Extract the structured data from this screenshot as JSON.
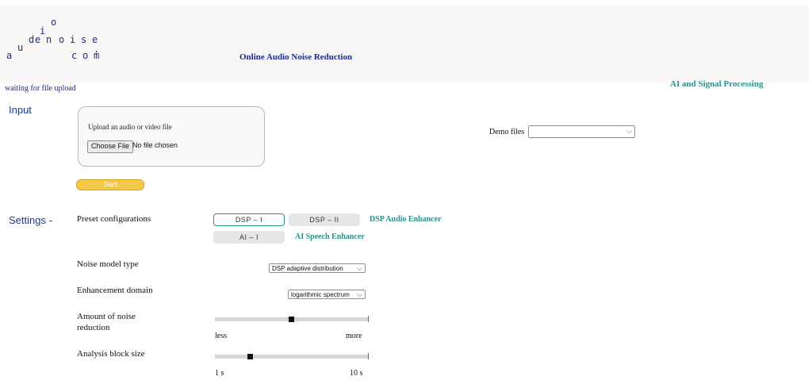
{
  "header": {
    "logo_letters": [
      "a",
      "u",
      "d",
      "i",
      "o",
      "e",
      "n",
      "o",
      "i",
      "s",
      "e",
      ".",
      "c",
      "o",
      "m"
    ],
    "site_title": "Online Audio Noise Reduction",
    "tagline": "AI and Signal Processing"
  },
  "status_text": "waiting for file upload",
  "input": {
    "section_label": "Input",
    "upload_label": "Upload an audio or video file",
    "choose_file_label": "Choose File",
    "file_status": "No file chosen",
    "start_label": "Start",
    "demo_label": "Demo files",
    "demo_selected": ""
  },
  "settings": {
    "section_label": "Settings -",
    "preset_label": "Preset configurations",
    "presets": [
      "DSP – I",
      "DSP – II",
      "AI – I"
    ],
    "dsp_enhancer": "DSP Audio Enhancer",
    "ai_enhancer": "AI Speech Enhancer",
    "noise_model_label": "Noise model type",
    "noise_model_value": "DSP adaptive distribution",
    "domain_label": "Enhancement domain",
    "domain_value": "logarithmic spectrum",
    "reduction_label": "Amount of noise reduction",
    "reduction_min": "less",
    "reduction_max": "more",
    "reduction_level": 0.5,
    "block_label": "Analysis block size",
    "block_min": "1 s",
    "block_max": "10 s",
    "block_level": 0.23
  },
  "colors": {
    "accent_teal": "#2b8f8f",
    "navy": "#1a2a8a",
    "start_yellow": "#f4c94a"
  }
}
